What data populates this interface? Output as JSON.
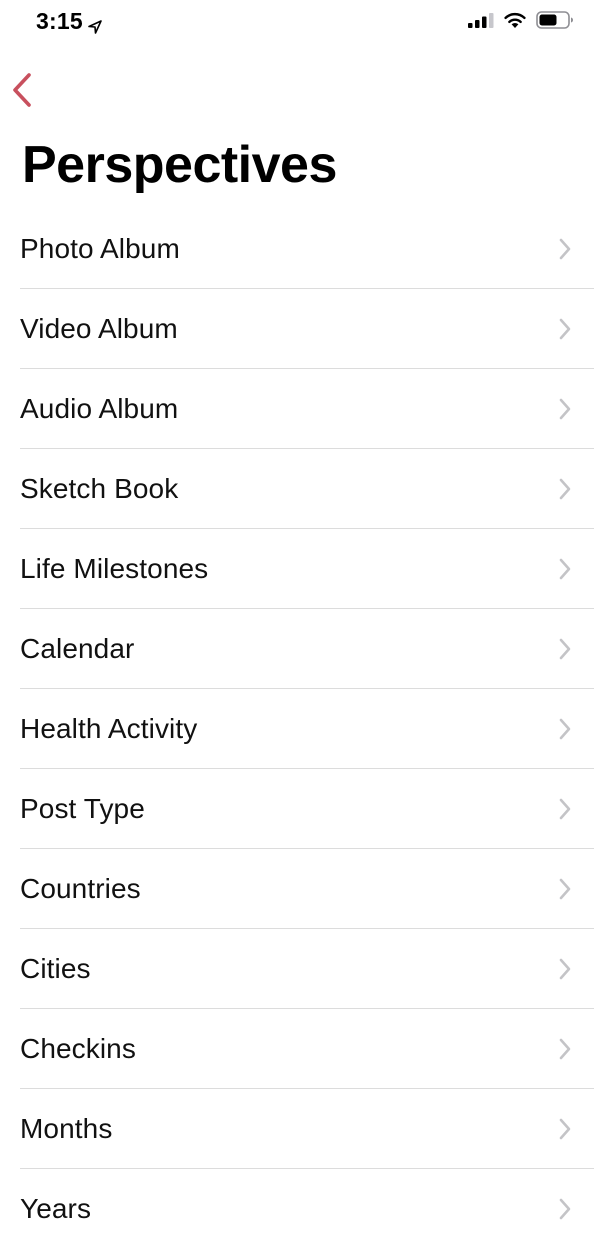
{
  "status_bar": {
    "time": "3:15"
  },
  "navigation": {
    "back_icon": "chevron-left-icon",
    "accent_color": "#c8505e"
  },
  "page": {
    "title": "Perspectives"
  },
  "list": {
    "items": [
      {
        "label": "Photo Album"
      },
      {
        "label": "Video Album"
      },
      {
        "label": "Audio Album"
      },
      {
        "label": "Sketch Book"
      },
      {
        "label": "Life Milestones"
      },
      {
        "label": "Calendar"
      },
      {
        "label": "Health Activity"
      },
      {
        "label": "Post Type"
      },
      {
        "label": "Countries"
      },
      {
        "label": "Cities"
      },
      {
        "label": "Checkins"
      },
      {
        "label": "Months"
      },
      {
        "label": "Years"
      }
    ],
    "chevron_icon": "chevron-right-icon",
    "chevron_color": "#c4c4c7",
    "divider_color": "#dcdcdc"
  }
}
